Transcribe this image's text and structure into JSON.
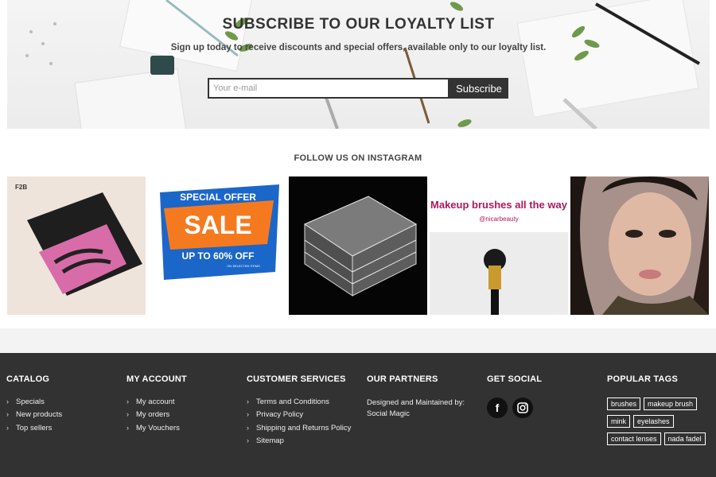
{
  "subscribe": {
    "title": "SUBSCRIBE TO OUR LOYALTY LIST",
    "subtitle": "Sign up today to receive discounts and special offers, available only to our loyalty list.",
    "email_placeholder": "Your e-mail",
    "button_label": "Subscribe"
  },
  "instagram": {
    "title": "FOLLOW US ON INSTAGRAM",
    "tiles": [
      {
        "name": "eyelash-box-photo",
        "label": "F2B"
      },
      {
        "name": "special-offer-sale-photo",
        "line1": "SPECIAL OFFER",
        "line2": "SALE",
        "line3": "UP TO 60% OFF",
        "line4": "ON SELECTED ITEMS"
      },
      {
        "name": "acrylic-lash-organizer-photo"
      },
      {
        "name": "makeup-brush-photo",
        "line1": "Makeup brushes all the way",
        "line2": "@nicarbeauty"
      },
      {
        "name": "model-portrait-photo"
      }
    ]
  },
  "footer": {
    "catalog": {
      "title": "CATALOG",
      "items": [
        "Specials",
        "New products",
        "Top sellers"
      ]
    },
    "account": {
      "title": "MY ACCOUNT",
      "items": [
        "My account",
        "My orders",
        "My Vouchers"
      ]
    },
    "services": {
      "title": "CUSTOMER SERVICES",
      "items": [
        "Terms and Conditions",
        "Privacy Policy",
        "Shipping and Returns Policy",
        "Sitemap"
      ]
    },
    "partners": {
      "title": "OUR PARTNERS",
      "text": "Designed and Maintained by: Social Magic"
    },
    "social": {
      "title": "GET SOCIAL",
      "icons": [
        "facebook-icon",
        "instagram-icon"
      ]
    },
    "tags": {
      "title": "POPULAR TAGS",
      "items": [
        "brushes",
        "makeup brush",
        "mink",
        "eyelashes",
        "contact lenses",
        "nada fadel"
      ]
    }
  },
  "colors": {
    "footer_bg": "#323232",
    "button_bg": "#333333",
    "strip_bg": "#f3f3f3"
  }
}
